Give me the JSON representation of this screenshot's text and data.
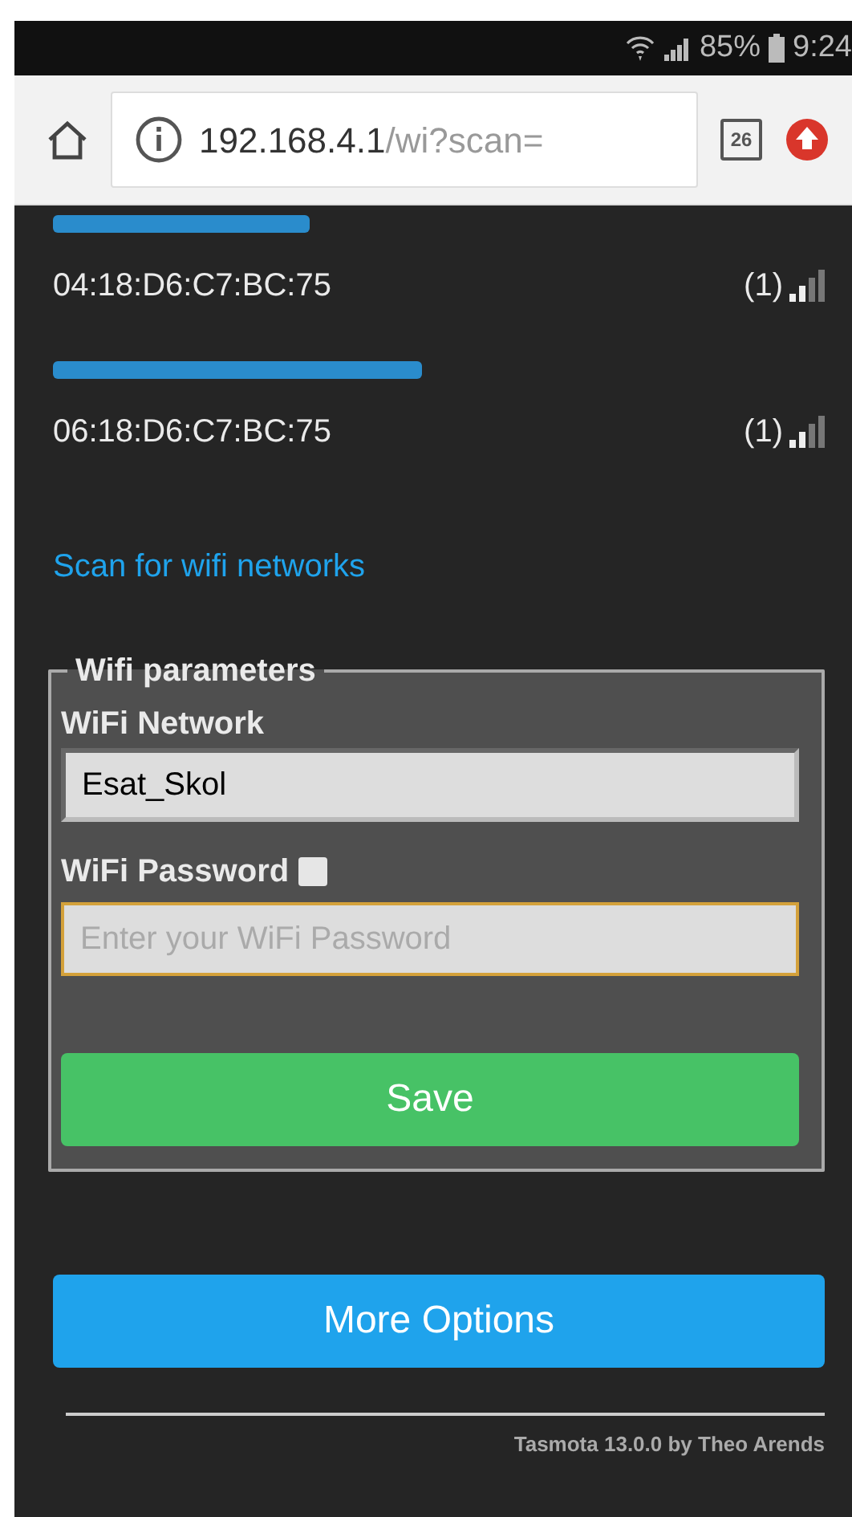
{
  "status_bar": {
    "battery": "85%",
    "time": "9:24"
  },
  "address_bar": {
    "host": "192.168.4.1",
    "path": "/wi?scan=",
    "tab_count": "26"
  },
  "networks": [
    {
      "mac": "04:18:D6:C7:BC:75",
      "channel": "(1)"
    },
    {
      "mac": "06:18:D6:C7:BC:75",
      "channel": "(1)"
    }
  ],
  "scan_link": "Scan for wifi networks",
  "fieldset": {
    "legend": "Wifi parameters",
    "network_label": "WiFi Network",
    "network_value": "Esat_Skol",
    "password_label": "WiFi Password",
    "show_password": false,
    "password_placeholder": "Enter your WiFi Password",
    "save_button": "Save"
  },
  "more_options_button": "More Options",
  "footer": "Tasmota 13.0.0 by Theo Arends"
}
